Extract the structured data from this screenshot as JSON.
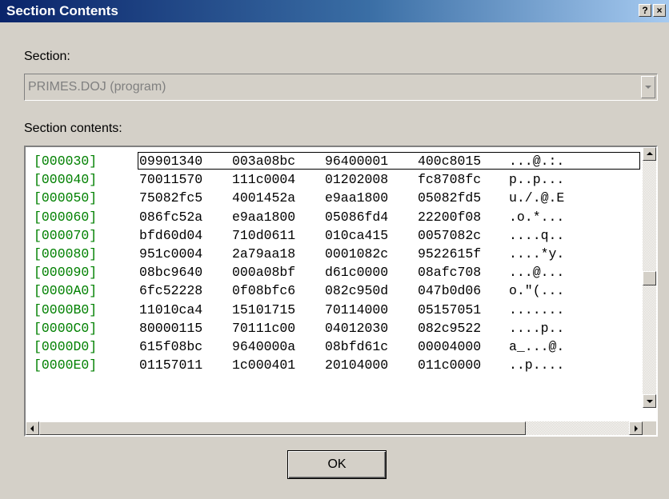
{
  "window": {
    "title": "Section Contents"
  },
  "title_buttons": {
    "help": "?",
    "close": "×"
  },
  "section": {
    "label": "Section:",
    "value": "PRIMES.DOJ (program)"
  },
  "contents": {
    "label": "Section contents:",
    "rows": [
      {
        "addr": "[000030]",
        "hex": [
          "09901340",
          "003a08bc",
          "96400001",
          "400c8015"
        ],
        "ascii": "...@.:."
      },
      {
        "addr": "[000040]",
        "hex": [
          "70011570",
          "111c0004",
          "01202008",
          "fc8708fc"
        ],
        "ascii": "p..p..."
      },
      {
        "addr": "[000050]",
        "hex": [
          "75082fc5",
          "4001452a",
          "e9aa1800",
          "05082fd5"
        ],
        "ascii": "u./.@.E"
      },
      {
        "addr": "[000060]",
        "hex": [
          "086fc52a",
          "e9aa1800",
          "05086fd4",
          "22200f08"
        ],
        "ascii": ".o.*..."
      },
      {
        "addr": "[000070]",
        "hex": [
          "bfd60d04",
          "710d0611",
          "010ca415",
          "0057082c"
        ],
        "ascii": "....q.."
      },
      {
        "addr": "[000080]",
        "hex": [
          "951c0004",
          "2a79aa18",
          "0001082c",
          "9522615f"
        ],
        "ascii": "....*y."
      },
      {
        "addr": "[000090]",
        "hex": [
          "08bc9640",
          "000a08bf",
          "d61c0000",
          "08afc708"
        ],
        "ascii": "...@..."
      },
      {
        "addr": "[0000A0]",
        "hex": [
          "6fc52228",
          "0f08bfc6",
          "082c950d",
          "047b0d06"
        ],
        "ascii": "o.\"(..."
      },
      {
        "addr": "[0000B0]",
        "hex": [
          "11010ca4",
          "15101715",
          "70114000",
          "05157051"
        ],
        "ascii": "......."
      },
      {
        "addr": "[0000C0]",
        "hex": [
          "80000115",
          "70111c00",
          "04012030",
          "082c9522"
        ],
        "ascii": "....p.."
      },
      {
        "addr": "[0000D0]",
        "hex": [
          "615f08bc",
          "9640000a",
          "08bfd61c",
          "00004000"
        ],
        "ascii": "a_...@."
      },
      {
        "addr": "[0000E0]",
        "hex": [
          "01157011",
          "1c000401",
          "20104000",
          "011c0000"
        ],
        "ascii": "..p...."
      }
    ]
  },
  "buttons": {
    "ok": "OK"
  },
  "colors": {
    "address": "#008000",
    "titlebar_start": "#0a246a",
    "titlebar_end": "#a6caf0",
    "dialog_bg": "#d4d0c8"
  }
}
